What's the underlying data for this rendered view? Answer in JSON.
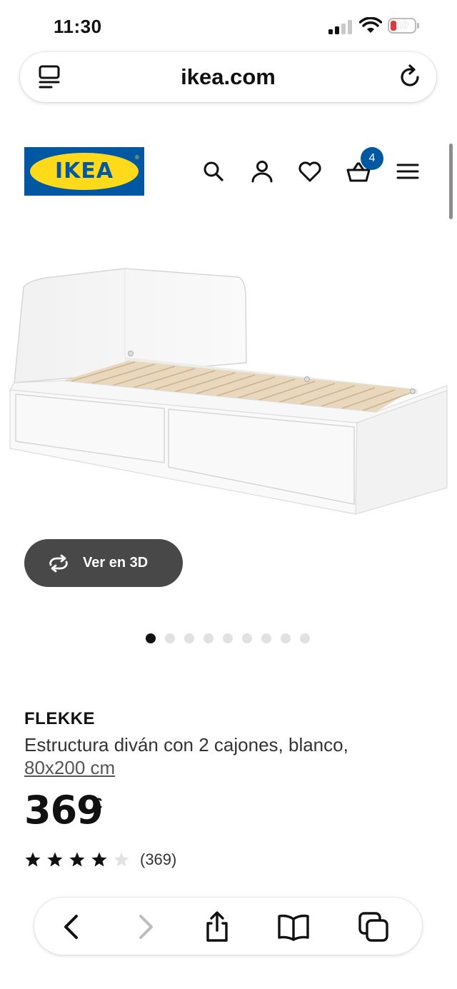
{
  "status_bar": {
    "time": "11:30",
    "battery_level": "10"
  },
  "browser": {
    "url": "ikea.com"
  },
  "header": {
    "logo_text": "IKEA",
    "cart_count": "4"
  },
  "gallery": {
    "view_3d_label": "Ver en 3D",
    "dot_count": 9,
    "active_dot": 1
  },
  "product": {
    "name": "FLEKKE",
    "description": "Estructura diván con 2 cajones, blanco,",
    "size": "80x200 cm",
    "price": "369",
    "currency": "€",
    "rating": 4.0,
    "rating_max": 5,
    "review_count": "(369)"
  },
  "colors": {
    "ikea_blue": "#0058a3",
    "ikea_yellow": "#ffda1a",
    "button_dark": "#484848"
  }
}
